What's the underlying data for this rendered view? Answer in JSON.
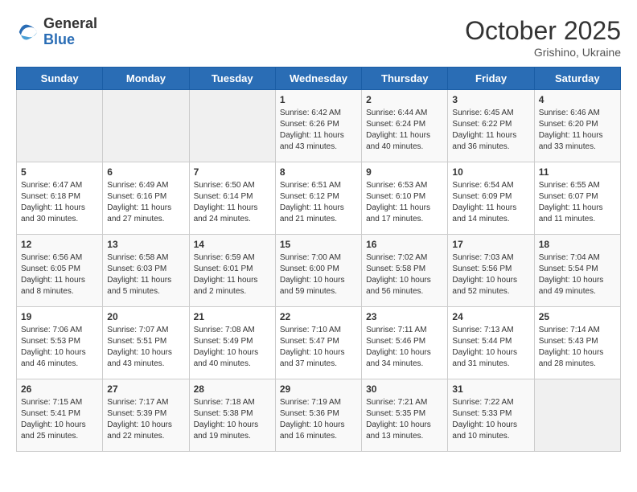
{
  "logo": {
    "general": "General",
    "blue": "Blue"
  },
  "header": {
    "month": "October 2025",
    "location": "Grishino, Ukraine"
  },
  "weekdays": [
    "Sunday",
    "Monday",
    "Tuesday",
    "Wednesday",
    "Thursday",
    "Friday",
    "Saturday"
  ],
  "weeks": [
    [
      {
        "day": "",
        "info": ""
      },
      {
        "day": "",
        "info": ""
      },
      {
        "day": "",
        "info": ""
      },
      {
        "day": "1",
        "info": "Sunrise: 6:42 AM\nSunset: 6:26 PM\nDaylight: 11 hours\nand 43 minutes."
      },
      {
        "day": "2",
        "info": "Sunrise: 6:44 AM\nSunset: 6:24 PM\nDaylight: 11 hours\nand 40 minutes."
      },
      {
        "day": "3",
        "info": "Sunrise: 6:45 AM\nSunset: 6:22 PM\nDaylight: 11 hours\nand 36 minutes."
      },
      {
        "day": "4",
        "info": "Sunrise: 6:46 AM\nSunset: 6:20 PM\nDaylight: 11 hours\nand 33 minutes."
      }
    ],
    [
      {
        "day": "5",
        "info": "Sunrise: 6:47 AM\nSunset: 6:18 PM\nDaylight: 11 hours\nand 30 minutes."
      },
      {
        "day": "6",
        "info": "Sunrise: 6:49 AM\nSunset: 6:16 PM\nDaylight: 11 hours\nand 27 minutes."
      },
      {
        "day": "7",
        "info": "Sunrise: 6:50 AM\nSunset: 6:14 PM\nDaylight: 11 hours\nand 24 minutes."
      },
      {
        "day": "8",
        "info": "Sunrise: 6:51 AM\nSunset: 6:12 PM\nDaylight: 11 hours\nand 21 minutes."
      },
      {
        "day": "9",
        "info": "Sunrise: 6:53 AM\nSunset: 6:10 PM\nDaylight: 11 hours\nand 17 minutes."
      },
      {
        "day": "10",
        "info": "Sunrise: 6:54 AM\nSunset: 6:09 PM\nDaylight: 11 hours\nand 14 minutes."
      },
      {
        "day": "11",
        "info": "Sunrise: 6:55 AM\nSunset: 6:07 PM\nDaylight: 11 hours\nand 11 minutes."
      }
    ],
    [
      {
        "day": "12",
        "info": "Sunrise: 6:56 AM\nSunset: 6:05 PM\nDaylight: 11 hours\nand 8 minutes."
      },
      {
        "day": "13",
        "info": "Sunrise: 6:58 AM\nSunset: 6:03 PM\nDaylight: 11 hours\nand 5 minutes."
      },
      {
        "day": "14",
        "info": "Sunrise: 6:59 AM\nSunset: 6:01 PM\nDaylight: 11 hours\nand 2 minutes."
      },
      {
        "day": "15",
        "info": "Sunrise: 7:00 AM\nSunset: 6:00 PM\nDaylight: 10 hours\nand 59 minutes."
      },
      {
        "day": "16",
        "info": "Sunrise: 7:02 AM\nSunset: 5:58 PM\nDaylight: 10 hours\nand 56 minutes."
      },
      {
        "day": "17",
        "info": "Sunrise: 7:03 AM\nSunset: 5:56 PM\nDaylight: 10 hours\nand 52 minutes."
      },
      {
        "day": "18",
        "info": "Sunrise: 7:04 AM\nSunset: 5:54 PM\nDaylight: 10 hours\nand 49 minutes."
      }
    ],
    [
      {
        "day": "19",
        "info": "Sunrise: 7:06 AM\nSunset: 5:53 PM\nDaylight: 10 hours\nand 46 minutes."
      },
      {
        "day": "20",
        "info": "Sunrise: 7:07 AM\nSunset: 5:51 PM\nDaylight: 10 hours\nand 43 minutes."
      },
      {
        "day": "21",
        "info": "Sunrise: 7:08 AM\nSunset: 5:49 PM\nDaylight: 10 hours\nand 40 minutes."
      },
      {
        "day": "22",
        "info": "Sunrise: 7:10 AM\nSunset: 5:47 PM\nDaylight: 10 hours\nand 37 minutes."
      },
      {
        "day": "23",
        "info": "Sunrise: 7:11 AM\nSunset: 5:46 PM\nDaylight: 10 hours\nand 34 minutes."
      },
      {
        "day": "24",
        "info": "Sunrise: 7:13 AM\nSunset: 5:44 PM\nDaylight: 10 hours\nand 31 minutes."
      },
      {
        "day": "25",
        "info": "Sunrise: 7:14 AM\nSunset: 5:43 PM\nDaylight: 10 hours\nand 28 minutes."
      }
    ],
    [
      {
        "day": "26",
        "info": "Sunrise: 7:15 AM\nSunset: 5:41 PM\nDaylight: 10 hours\nand 25 minutes."
      },
      {
        "day": "27",
        "info": "Sunrise: 7:17 AM\nSunset: 5:39 PM\nDaylight: 10 hours\nand 22 minutes."
      },
      {
        "day": "28",
        "info": "Sunrise: 7:18 AM\nSunset: 5:38 PM\nDaylight: 10 hours\nand 19 minutes."
      },
      {
        "day": "29",
        "info": "Sunrise: 7:19 AM\nSunset: 5:36 PM\nDaylight: 10 hours\nand 16 minutes."
      },
      {
        "day": "30",
        "info": "Sunrise: 7:21 AM\nSunset: 5:35 PM\nDaylight: 10 hours\nand 13 minutes."
      },
      {
        "day": "31",
        "info": "Sunrise: 7:22 AM\nSunset: 5:33 PM\nDaylight: 10 hours\nand 10 minutes."
      },
      {
        "day": "",
        "info": ""
      }
    ]
  ]
}
